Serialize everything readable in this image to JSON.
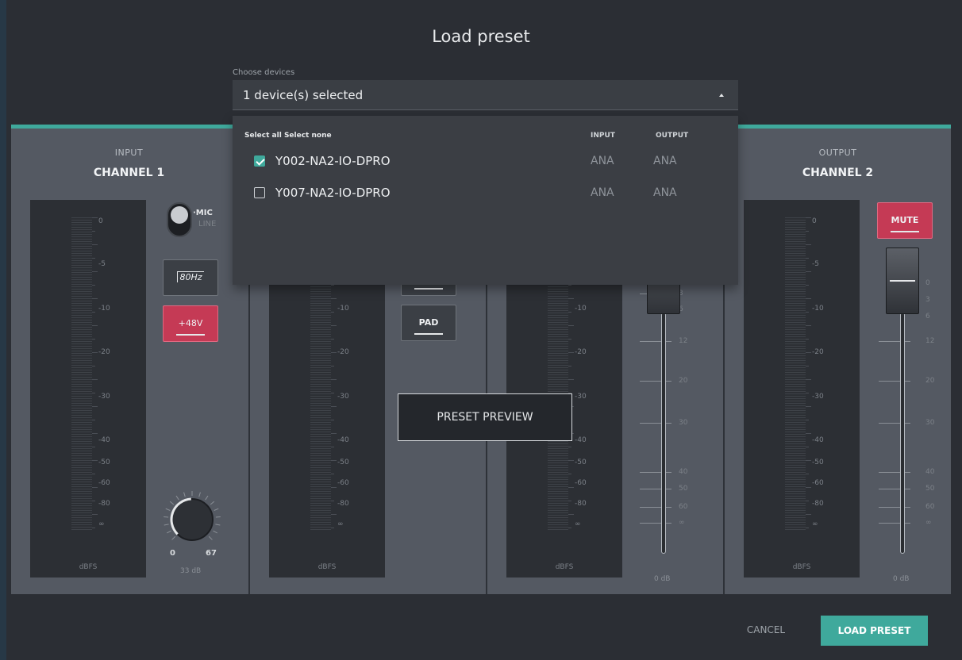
{
  "dialog": {
    "title": "Load preset"
  },
  "devices": {
    "label": "Choose devices",
    "selected_text": "1 device(s) selected",
    "select_all": "Select all",
    "select_none": "Select none",
    "col_input": "INPUT",
    "col_output": "OUTPUT",
    "rows": [
      {
        "name": "Y002-NA2-IO-DPRO",
        "input": "ANA",
        "output": "ANA",
        "checked": true
      },
      {
        "name": "Y007-NA2-IO-DPRO",
        "input": "ANA",
        "output": "ANA",
        "checked": false
      }
    ]
  },
  "preview": {
    "overlay_label": "PRESET PREVIEW",
    "meter_scale": [
      "0",
      "-5",
      "-10",
      "-20",
      "-30",
      "-40",
      "-50",
      "-60",
      "-80",
      "∞"
    ],
    "meter_unit": "dBFS",
    "fader_scale": [
      "0",
      "3",
      "6",
      "12",
      "20",
      "30",
      "40",
      "50",
      "60",
      "∞"
    ],
    "strips": [
      {
        "header_top": "INPUT",
        "header_main": "CHANNEL 1",
        "mic_label": "·MIC",
        "line_label": "LINE",
        "hpf_label": "80Hz",
        "phantom_label": "+48V",
        "knob_min": "0",
        "knob_max": "67",
        "gain_value": "33 dB",
        "gain_fraction": 0.49
      },
      {
        "pad_label": "PAD"
      },
      {
        "fader_value": "0 dB"
      },
      {
        "header_top": "OUTPUT",
        "header_main": "CHANNEL 2",
        "mute_label": "MUTE",
        "fader_value": "0 dB"
      }
    ]
  },
  "footer": {
    "cancel": "CANCEL",
    "load": "LOAD PRESET"
  },
  "colors": {
    "accent": "#3fa99c",
    "danger": "#c53a55",
    "background": "#2b2e34"
  }
}
